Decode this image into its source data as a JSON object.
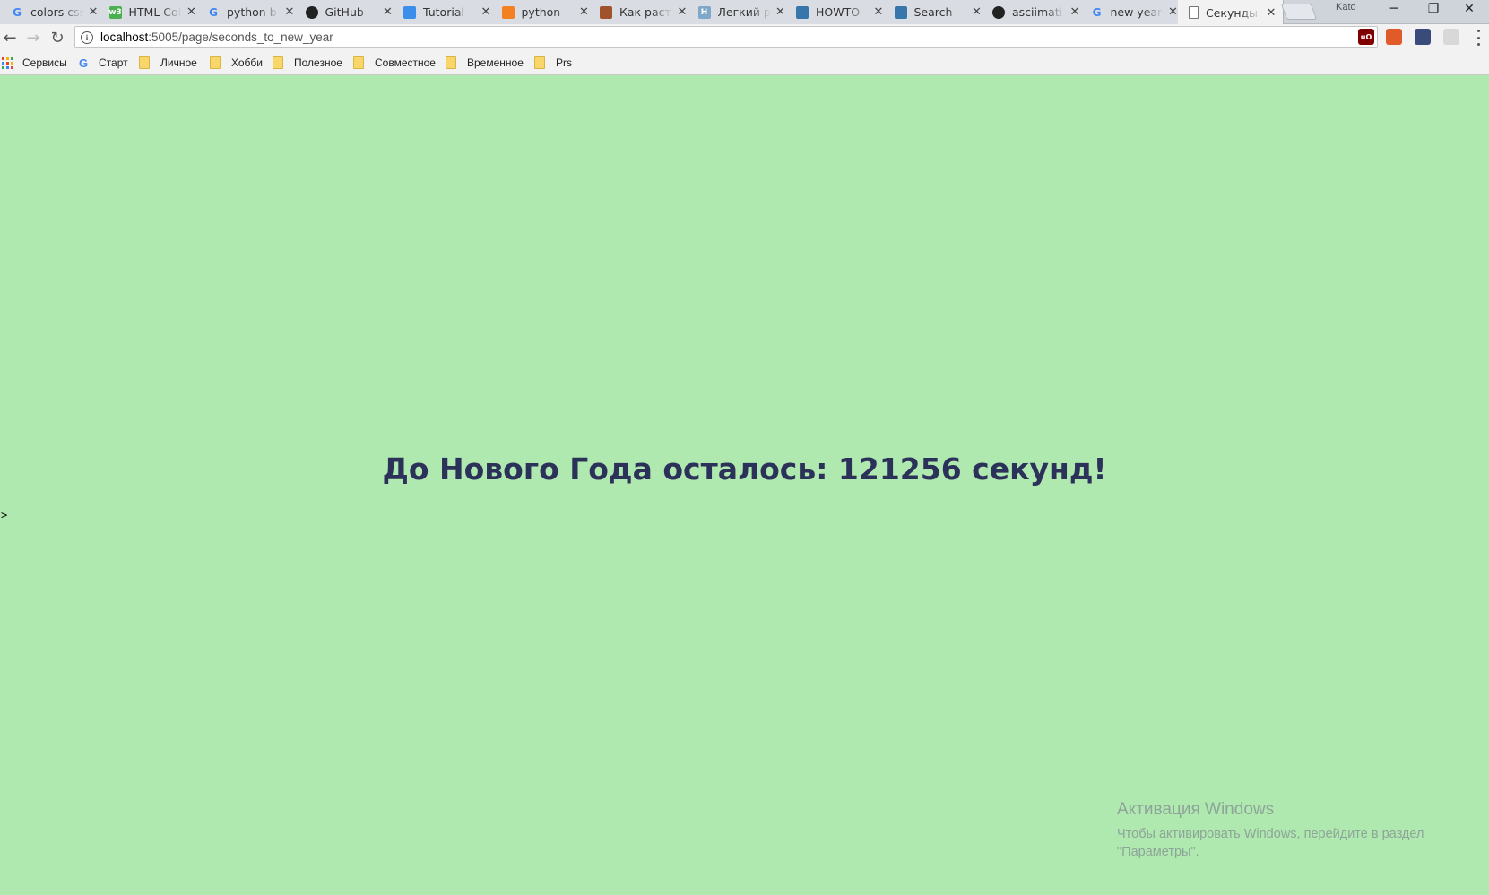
{
  "browser": {
    "tabs": [
      {
        "title": "colors css",
        "icon": "google-icon",
        "icon_text": "G",
        "icon_color": "#4285f4",
        "active": false
      },
      {
        "title": "HTML Color",
        "icon": "w3schools-icon",
        "icon_text": "w3",
        "icon_color": "#4caf50",
        "active": false
      },
      {
        "title": "python b",
        "icon": "google-icon",
        "icon_text": "G",
        "icon_color": "#4285f4",
        "active": false
      },
      {
        "title": "GitHub -",
        "icon": "github-icon",
        "icon_text": "",
        "icon_color": "#222222",
        "active": false
      },
      {
        "title": "Tutorial -",
        "icon": "flask-icon",
        "icon_text": "",
        "icon_color": "#3b8eea",
        "active": false
      },
      {
        "title": "python -",
        "icon": "stackoverflow-icon",
        "icon_text": "",
        "icon_color": "#f48024",
        "active": false
      },
      {
        "title": "Как раст",
        "icon": "site-icon",
        "icon_text": "",
        "icon_color": "#a0522d",
        "active": false
      },
      {
        "title": "Легкий р",
        "icon": "habr-icon",
        "icon_text": "H",
        "icon_color": "#7fa7c7",
        "active": false
      },
      {
        "title": "HOWTO",
        "icon": "python-icon",
        "icon_text": "",
        "icon_color": "#3776ab",
        "active": false
      },
      {
        "title": "Search —",
        "icon": "python-icon",
        "icon_text": "",
        "icon_color": "#3776ab",
        "active": false
      },
      {
        "title": "asciimati",
        "icon": "github-icon",
        "icon_text": "",
        "icon_color": "#222222",
        "active": false
      },
      {
        "title": "new year",
        "icon": "google-icon",
        "icon_text": "G",
        "icon_color": "#4285f4",
        "active": false
      },
      {
        "title": "Секунды",
        "icon": "page-icon",
        "icon_text": "",
        "icon_color": "#777777",
        "active": true
      }
    ],
    "profile_name": "Kato",
    "window_controls": {
      "minimize": "─",
      "restore": "❐",
      "close": "✕"
    },
    "url_host": "localhost",
    "url_path": ":5005/page/seconds_to_new_year",
    "bookmarks": {
      "apps_label": "Сервисы",
      "start_label": "Старт",
      "folders": [
        "Личное",
        "Хобби",
        "Полезное",
        "Совместное",
        "Временное",
        "Prs"
      ]
    }
  },
  "page": {
    "background": "#afe9af",
    "headline": "До Нового Года осталось: 121256 секунд!",
    "headline_color": "#2b3158",
    "stray_text": ">",
    "seconds_remaining": 121256
  },
  "windows_activation": {
    "title": "Активация Windows",
    "text": "Чтобы активировать Windows, перейдите в раздел \"Параметры\"."
  }
}
